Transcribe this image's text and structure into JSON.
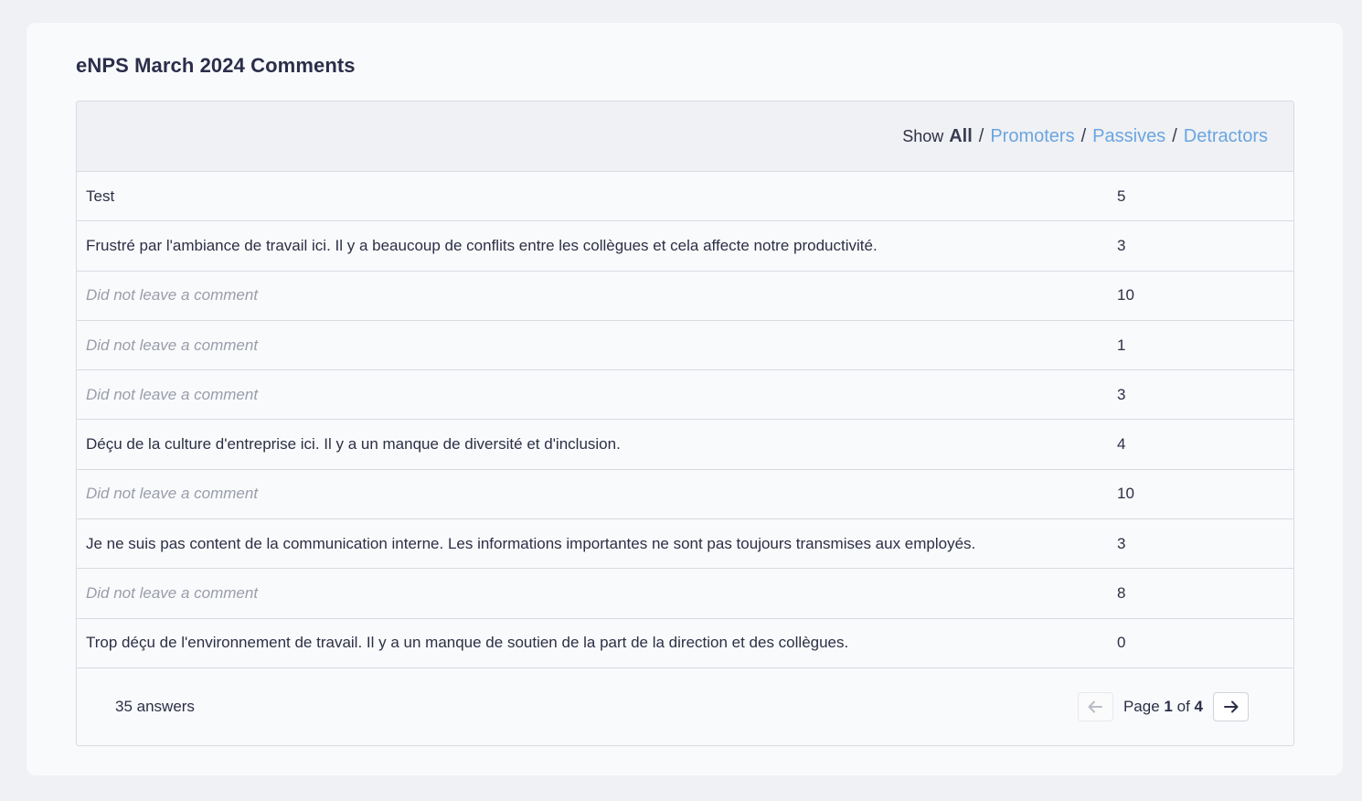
{
  "title": "eNPS March 2024 Comments",
  "filters": {
    "show_label": "Show",
    "all": "All",
    "separator": "/",
    "promoters": "Promoters",
    "passives": "Passives",
    "detractors": "Detractors"
  },
  "rows": [
    {
      "comment": "Test",
      "score": "5"
    },
    {
      "comment": "Frustré par l'ambiance de travail ici. Il y a beaucoup de conflits entre les collègues et cela affecte notre productivité.",
      "score": "3"
    },
    {
      "comment": "Did not leave a comment",
      "score": "10"
    },
    {
      "comment": "Did not leave a comment",
      "score": "1"
    },
    {
      "comment": "Did not leave a comment",
      "score": "3"
    },
    {
      "comment": "Déçu de la culture d'entreprise ici. Il y a un manque de diversité et d'inclusion.",
      "score": "4"
    },
    {
      "comment": "Did not leave a comment",
      "score": "10"
    },
    {
      "comment": "Je ne suis pas content de la communication interne. Les informations importantes ne sont pas toujours transmises aux employés.",
      "score": "3"
    },
    {
      "comment": "Did not leave a comment",
      "score": "8"
    },
    {
      "comment": "Trop déçu de l'environnement de travail. Il y a un manque de soutien de la part de la direction et des collègues.",
      "score": "0"
    }
  ],
  "footer": {
    "answers": "35 answers",
    "page_label": "Page",
    "page_current": "1",
    "page_of": "of",
    "page_total": "4"
  },
  "colors": {
    "link": "#6aa5e0",
    "empty_comment": "#9a9daa",
    "text": "#2d2f45"
  },
  "icons": {
    "prev": "arrow-left-icon",
    "next": "arrow-right-icon"
  }
}
